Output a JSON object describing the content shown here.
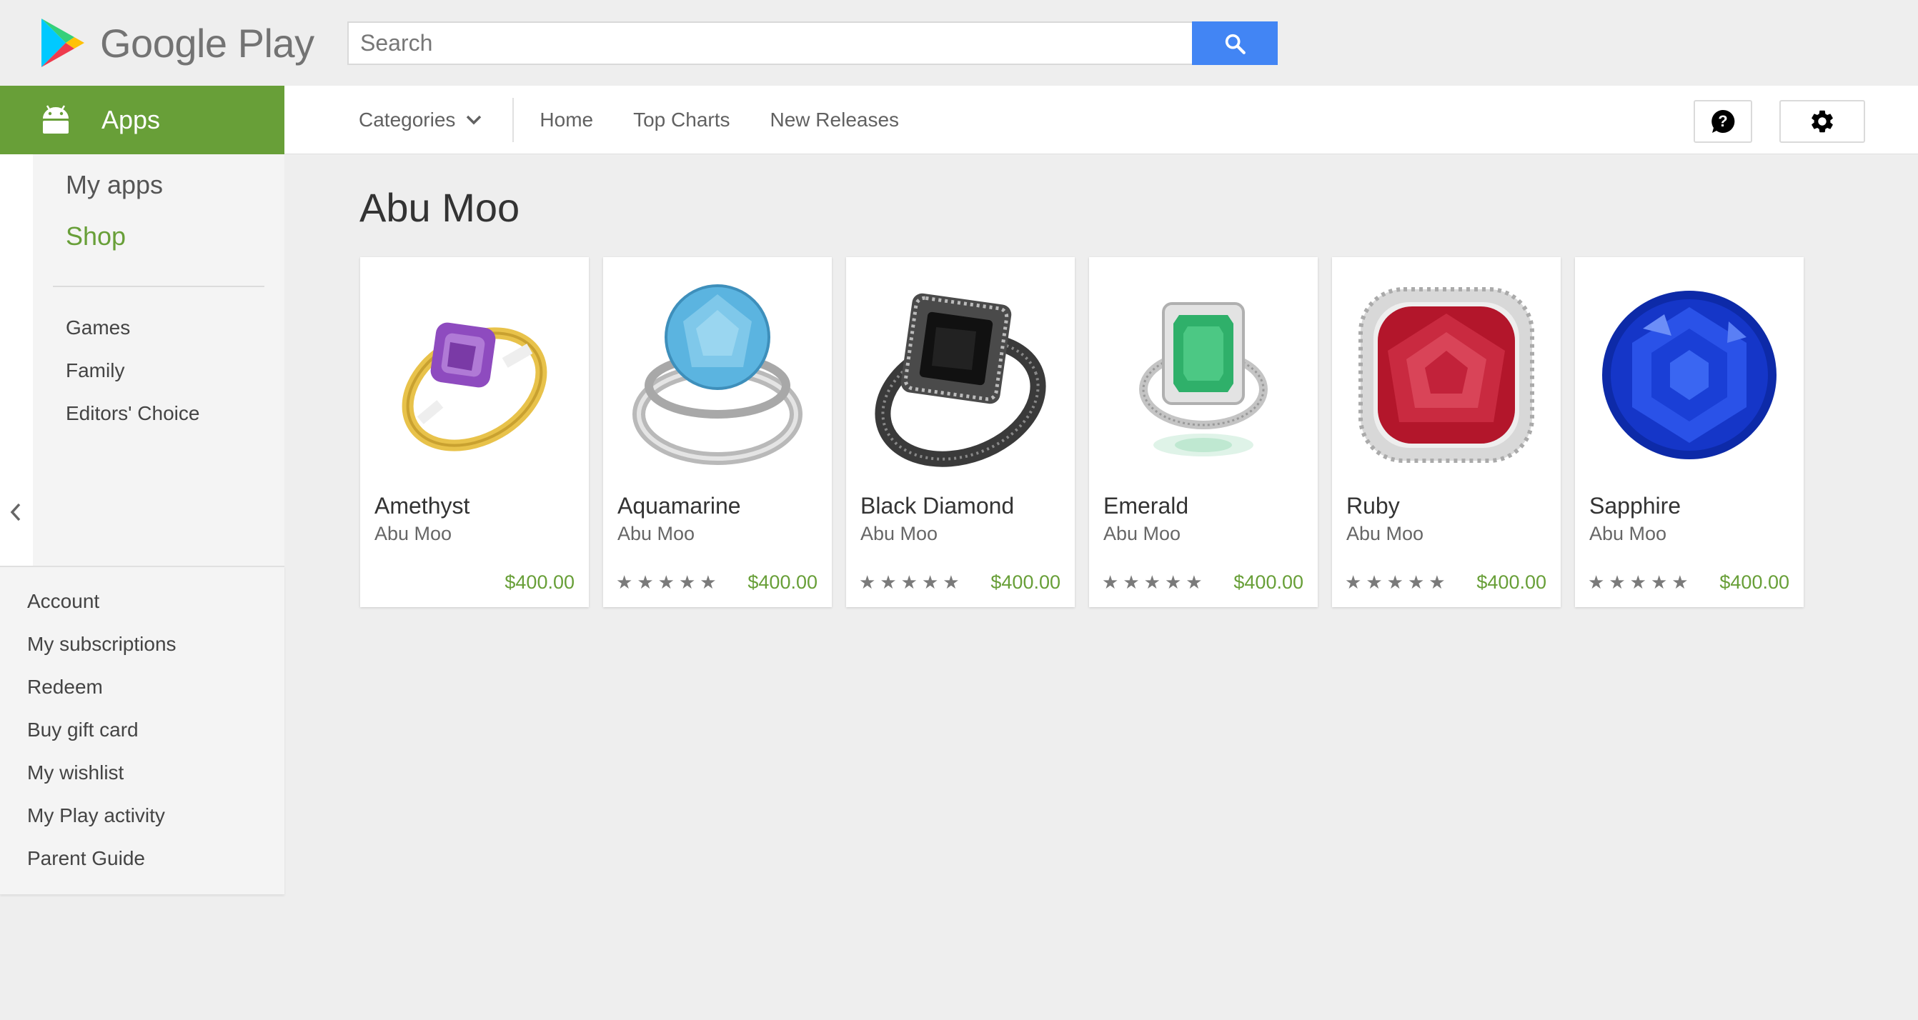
{
  "header": {
    "logo_text": "Google Play",
    "search_placeholder": "Search"
  },
  "nav": {
    "apps_label": "Apps",
    "categories_label": "Categories",
    "links": [
      "Home",
      "Top Charts",
      "New Releases"
    ]
  },
  "sidebar": {
    "main": [
      "My apps",
      "Shop"
    ],
    "sub": [
      "Games",
      "Family",
      "Editors' Choice"
    ],
    "account": [
      "Account",
      "My subscriptions",
      "Redeem",
      "Buy gift card",
      "My wishlist",
      "My Play activity",
      "Parent Guide"
    ]
  },
  "page": {
    "title": "Abu Moo"
  },
  "cards": [
    {
      "title": "Amethyst",
      "developer": "Abu Moo",
      "price": "$400.00",
      "stars": 0,
      "gem_color": "#9c5cc8",
      "band_color": "#e8c24a"
    },
    {
      "title": "Aquamarine",
      "developer": "Abu Moo",
      "price": "$400.00",
      "stars": 5,
      "gem_color": "#5bb4e0",
      "band_color": "#c4c4c4"
    },
    {
      "title": "Black Diamond",
      "developer": "Abu Moo",
      "price": "$400.00",
      "stars": 5,
      "gem_color": "#1a1a1a",
      "band_color": "#555555"
    },
    {
      "title": "Emerald",
      "developer": "Abu Moo",
      "price": "$400.00",
      "stars": 5,
      "gem_color": "#2fb06a",
      "band_color": "#cfcfcf"
    },
    {
      "title": "Ruby",
      "developer": "Abu Moo",
      "price": "$400.00",
      "stars": 5,
      "gem_color": "#b3162b",
      "band_color": "#d8d8d8"
    },
    {
      "title": "Sapphire",
      "developer": "Abu Moo",
      "price": "$400.00",
      "stars": 5,
      "gem_color": "#1536c8",
      "band_color": "#1536c8"
    }
  ],
  "colors": {
    "brand_green": "#689f38",
    "search_blue": "#4285f4"
  }
}
